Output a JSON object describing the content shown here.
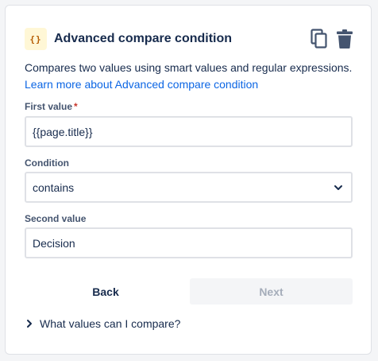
{
  "header": {
    "badge_text": "{}",
    "title": "Advanced compare condition",
    "copy_icon": "copy-icon",
    "delete_icon": "trash-icon"
  },
  "description": {
    "text": "Compares two values using smart values and regular expressions.",
    "link": "Learn more about Advanced compare condition"
  },
  "fields": {
    "first_value": {
      "label": "First value",
      "required_marker": "*",
      "value": "{{page.title}}"
    },
    "condition": {
      "label": "Condition",
      "selected": "contains"
    },
    "second_value": {
      "label": "Second value",
      "value": "Decision"
    }
  },
  "actions": {
    "back": "Back",
    "next": "Next"
  },
  "disclosure": {
    "label": "What values can I compare?"
  },
  "colors": {
    "link": "#0c66e4",
    "required": "#c9372c",
    "badge_bg": "#fff7d6",
    "badge_fg": "#b65c02"
  }
}
